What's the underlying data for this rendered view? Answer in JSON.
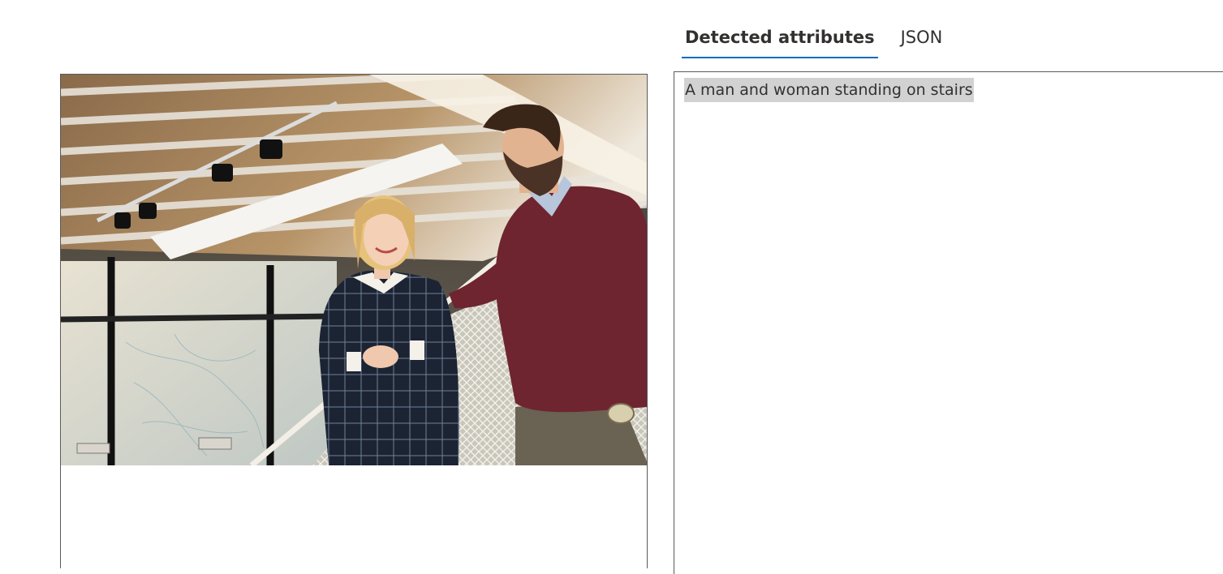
{
  "tabs": [
    {
      "label": "Detected attributes",
      "active": true
    },
    {
      "label": "JSON",
      "active": false
    }
  ],
  "result": {
    "caption": "A man and woman standing on stairs"
  },
  "colors": {
    "tab_underline": "#0f6cbd",
    "caption_highlight": "#d2d2d2",
    "panel_border": "#5a5a5a"
  }
}
